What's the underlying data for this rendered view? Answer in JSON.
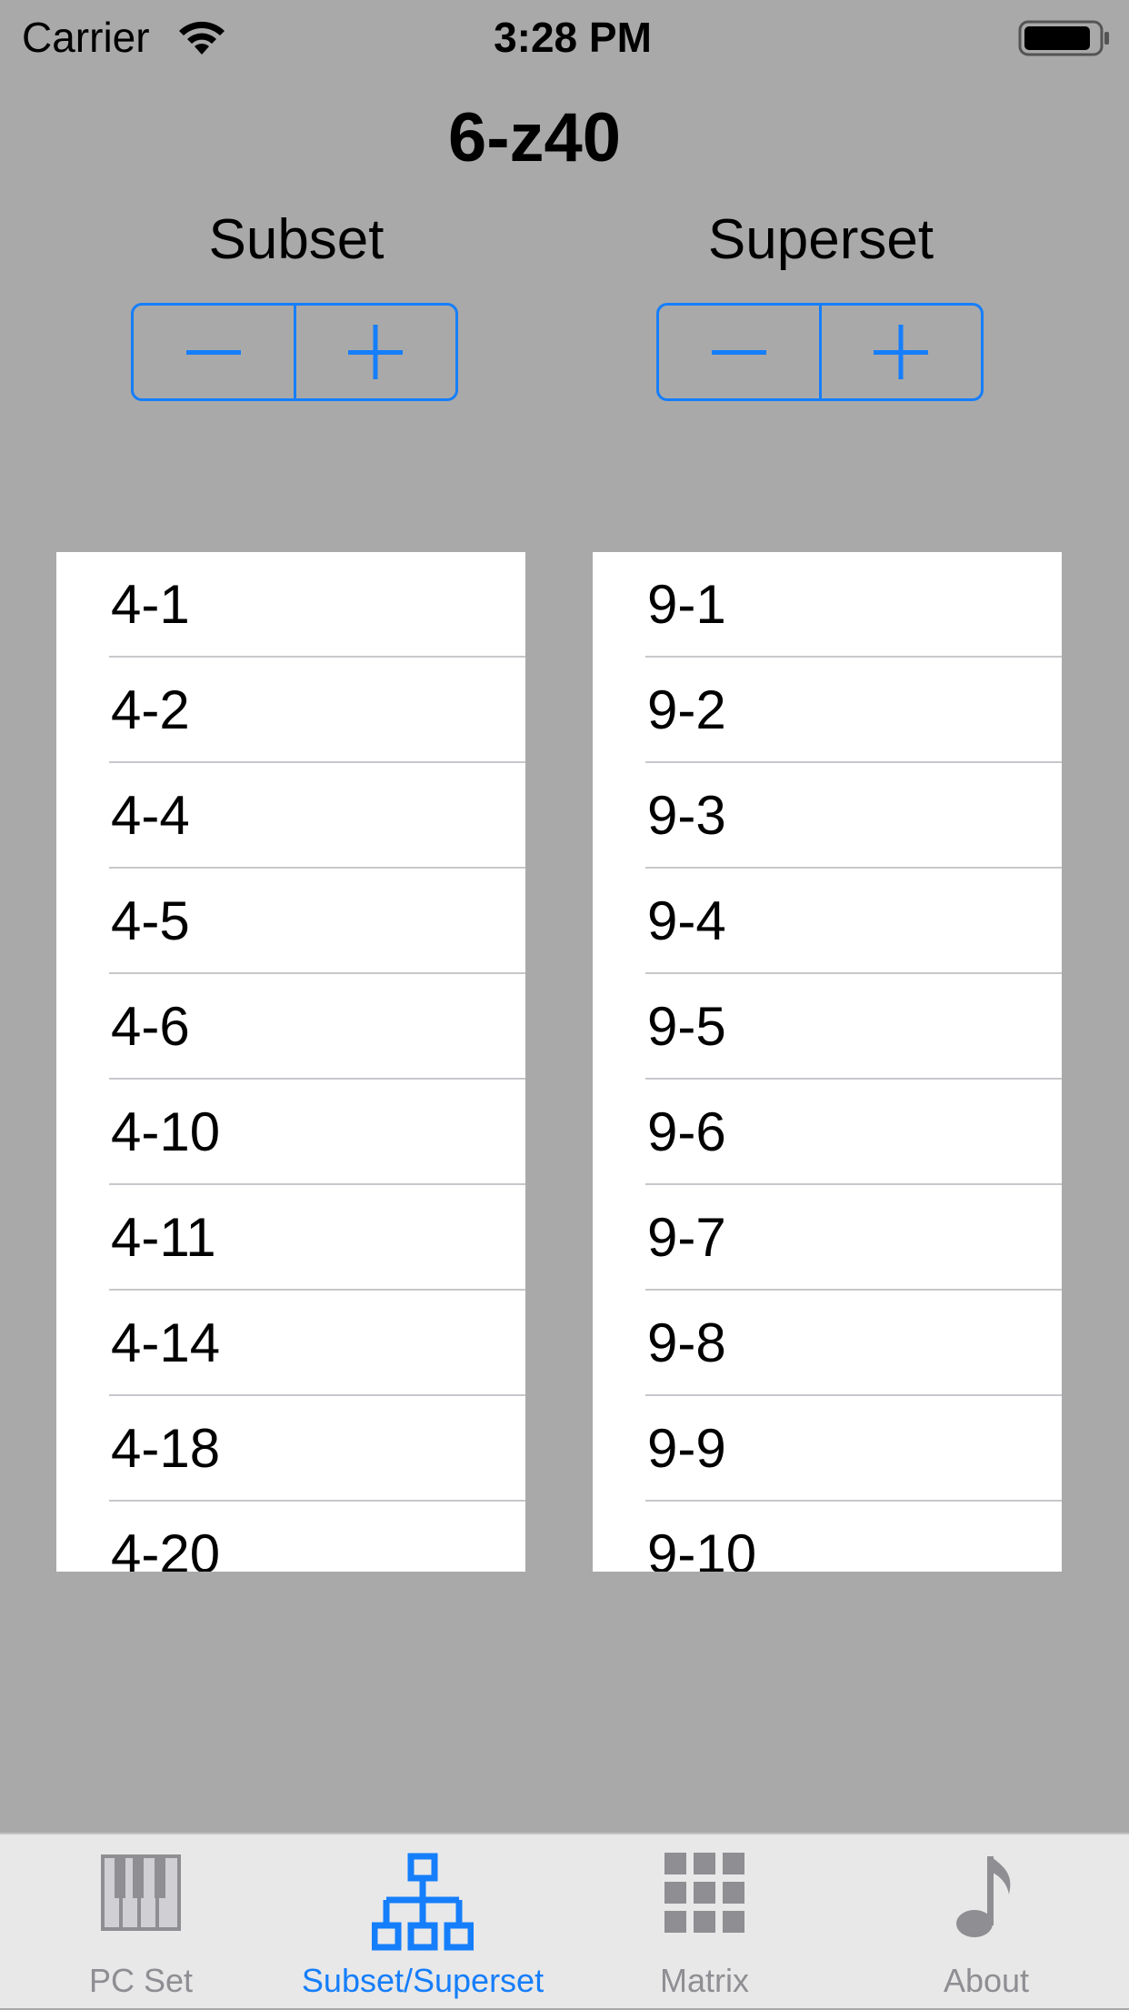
{
  "status_bar": {
    "carrier": "Carrier",
    "time": "3:28 PM"
  },
  "title": "6-z40",
  "subset": {
    "label": "Subset",
    "decrement": "−",
    "increment": "+",
    "items": [
      "4-1",
      "4-2",
      "4-4",
      "4-5",
      "4-6",
      "4-10",
      "4-11",
      "4-14",
      "4-18",
      "4-20"
    ]
  },
  "superset": {
    "label": "Superset",
    "decrement": "−",
    "increment": "+",
    "items": [
      "9-1",
      "9-2",
      "9-3",
      "9-4",
      "9-5",
      "9-6",
      "9-7",
      "9-8",
      "9-9",
      "9-10"
    ]
  },
  "tabs": [
    {
      "label": "PC Set",
      "icon": "piano-keys-icon",
      "active": false
    },
    {
      "label": "Subset/Superset",
      "icon": "hierarchy-icon",
      "active": true
    },
    {
      "label": "Matrix",
      "icon": "grid-icon",
      "active": false
    },
    {
      "label": "About",
      "icon": "music-note-icon",
      "active": false
    }
  ],
  "colors": {
    "accent": "#157efb",
    "background": "#a9a9a9",
    "tab_inactive": "#8e8e93"
  }
}
